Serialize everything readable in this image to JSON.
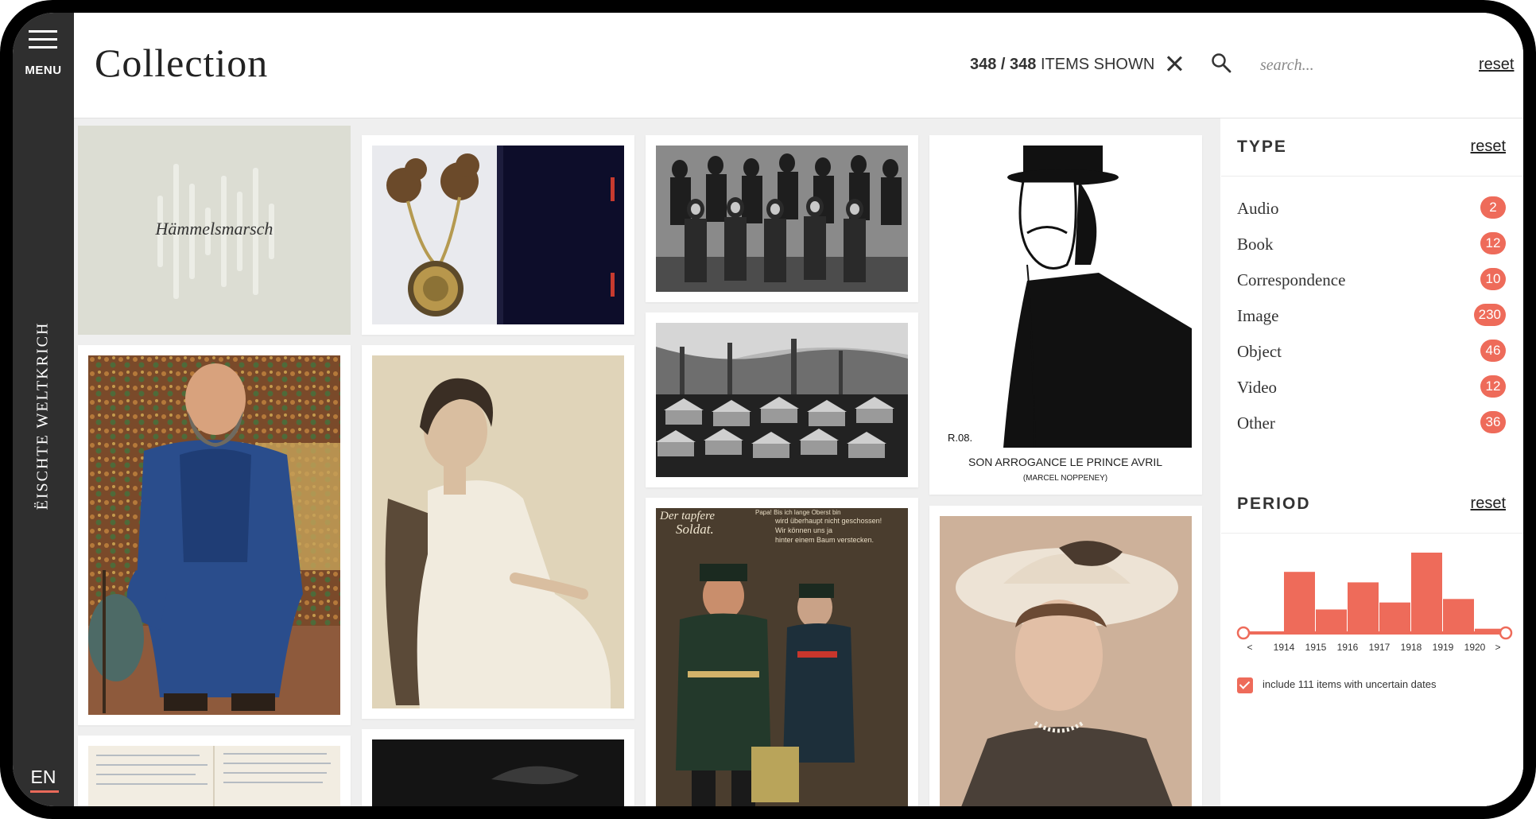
{
  "rail": {
    "menu_label": "MENU",
    "site_title": "ËISCHTE WELTKRICH",
    "language": "EN"
  },
  "header": {
    "title": "Collection",
    "count_shown": "348",
    "count_sep": " / ",
    "count_total": "348",
    "count_suffix": " ITEMS SHOWN",
    "search_placeholder": "search...",
    "reset_label": "reset"
  },
  "grid": {
    "audio_item": {
      "title": "Hämmelsmarsch",
      "type": "Audio"
    },
    "items": [
      {
        "kind": "object",
        "subject": "book with medal and tassels"
      },
      {
        "kind": "image",
        "subject": "group photograph of workers"
      },
      {
        "kind": "image",
        "subject": "factory town panorama"
      },
      {
        "kind": "image",
        "subject": "Der tapfere Soldat postcard"
      },
      {
        "kind": "image",
        "subject": "caricature"
      },
      {
        "kind": "image",
        "subject": "portrait painting of bearded man"
      },
      {
        "kind": "image",
        "subject": "seated woman portrait"
      },
      {
        "kind": "image",
        "subject": "woman in hat portrait"
      }
    ],
    "caricature_caption": "SON ARROGANCE LE PRINCE AVRIL",
    "caricature_subcaption": "(MARCEL NOPPENEY)",
    "caricature_signature": "R.08.",
    "postcard_title": "Der tapfere Soldat.",
    "postcard_text": "Papa! Bis ich lange Oberst bin wird überhaupt nicht geschossen! Wir können uns ja hinter einem Baum verstecken."
  },
  "filters": {
    "type": {
      "heading": "TYPE",
      "reset_label": "reset",
      "items": [
        {
          "label": "Audio",
          "count": "2"
        },
        {
          "label": "Book",
          "count": "12"
        },
        {
          "label": "Correspondence",
          "count": "10"
        },
        {
          "label": "Image",
          "count": "230"
        },
        {
          "label": "Object",
          "count": "46"
        },
        {
          "label": "Video",
          "count": "12"
        },
        {
          "label": "Other",
          "count": "36"
        }
      ]
    },
    "period": {
      "heading": "PERIOD",
      "reset_label": "reset",
      "axis_labels": [
        "<",
        "1914",
        "1915",
        "1916",
        "1917",
        "1918",
        "1919",
        "1920",
        ">"
      ],
      "bar_levels": [
        0.0,
        0.68,
        0.25,
        0.56,
        0.33,
        0.9,
        0.37,
        0.03
      ],
      "uncertain_label": "include 111 items with uncertain dates",
      "uncertain_checked": true
    }
  },
  "colors": {
    "accent": "#ee6b5a",
    "rail": "#2f2f2f",
    "grid_bg": "#efefef"
  }
}
